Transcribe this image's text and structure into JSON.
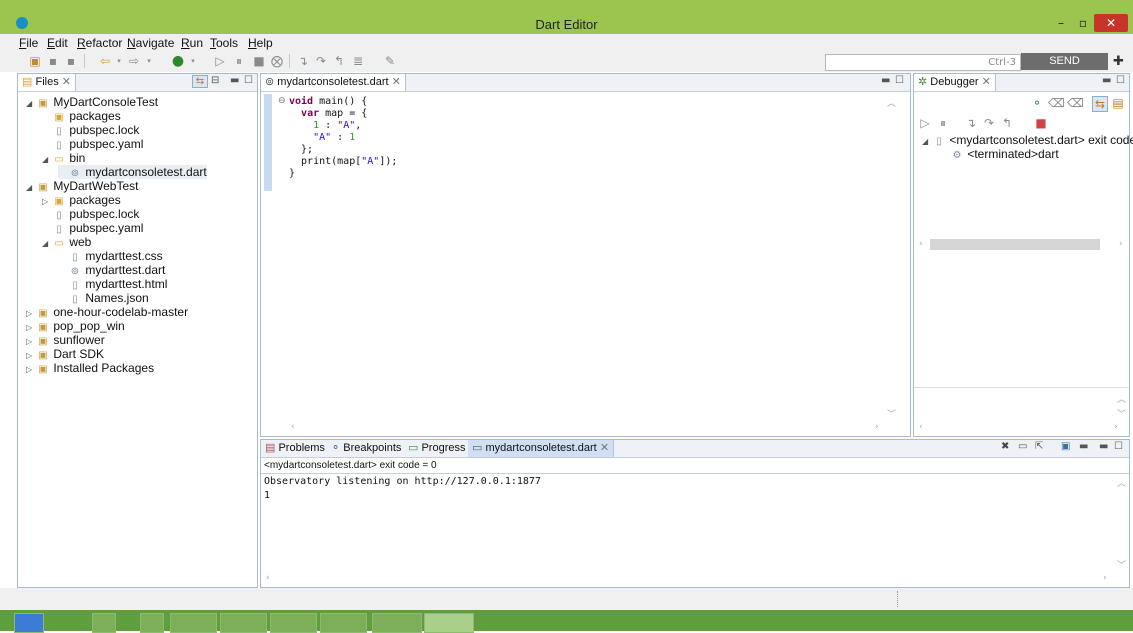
{
  "window": {
    "title": "Dart Editor",
    "min": "–",
    "max": "▫",
    "close": "✕"
  },
  "menu": [
    "File",
    "Edit",
    "Refactor",
    "Navigate",
    "Run",
    "Tools",
    "Help"
  ],
  "toolbar": {
    "search_placeholder": "Ctrl-3",
    "feedback_label": "SEND FEEDBACK"
  },
  "files_panel": {
    "tab": "Files",
    "tree": [
      {
        "label": "MyDartConsoleTest",
        "depth": 0,
        "twisty": "expanded",
        "icon": "project-folder"
      },
      {
        "label": "packages",
        "depth": 1,
        "twisty": "none",
        "icon": "package-folder"
      },
      {
        "label": "pubspec.lock",
        "depth": 1,
        "twisty": "none",
        "icon": "file"
      },
      {
        "label": "pubspec.yaml",
        "depth": 1,
        "twisty": "none",
        "icon": "yaml-file"
      },
      {
        "label": "bin",
        "depth": 1,
        "twisty": "expanded",
        "icon": "folder"
      },
      {
        "label": "mydartconsoletest.dart",
        "depth": 2,
        "twisty": "none",
        "icon": "dart-file",
        "selected": true
      },
      {
        "label": "MyDartWebTest",
        "depth": 0,
        "twisty": "expanded",
        "icon": "project-folder"
      },
      {
        "label": "packages",
        "depth": 1,
        "twisty": "collapsed",
        "icon": "package-folder"
      },
      {
        "label": "pubspec.lock",
        "depth": 1,
        "twisty": "none",
        "icon": "file"
      },
      {
        "label": "pubspec.yaml",
        "depth": 1,
        "twisty": "none",
        "icon": "yaml-file"
      },
      {
        "label": "web",
        "depth": 1,
        "twisty": "expanded",
        "icon": "folder"
      },
      {
        "label": "mydarttest.css",
        "depth": 2,
        "twisty": "none",
        "icon": "file"
      },
      {
        "label": "mydarttest.dart",
        "depth": 2,
        "twisty": "none",
        "icon": "dart-file"
      },
      {
        "label": "mydarttest.html",
        "depth": 2,
        "twisty": "none",
        "icon": "file"
      },
      {
        "label": "Names.json",
        "depth": 2,
        "twisty": "none",
        "icon": "file"
      },
      {
        "label": "one-hour-codelab-master",
        "depth": 0,
        "twisty": "collapsed",
        "icon": "project-folder"
      },
      {
        "label": "pop_pop_win",
        "depth": 0,
        "twisty": "collapsed",
        "icon": "project-folder"
      },
      {
        "label": "sunflower",
        "depth": 0,
        "twisty": "collapsed",
        "icon": "project-folder"
      },
      {
        "label": "Dart SDK",
        "depth": 0,
        "twisty": "collapsed",
        "icon": "library-folder"
      },
      {
        "label": "Installed Packages",
        "depth": 0,
        "twisty": "collapsed",
        "icon": "library-folder"
      }
    ]
  },
  "editor": {
    "tab": "mydartconsoletest.dart",
    "lines": [
      [
        {
          "t": "void",
          "c": "kw"
        },
        {
          "t": " main() {",
          "c": ""
        }
      ],
      [
        {
          "t": "  ",
          "c": ""
        },
        {
          "t": "var",
          "c": "kw"
        },
        {
          "t": " map = {",
          "c": ""
        }
      ],
      [
        {
          "t": "    ",
          "c": ""
        },
        {
          "t": "1",
          "c": "num"
        },
        {
          "t": " : ",
          "c": ""
        },
        {
          "t": "\"A\"",
          "c": "str"
        },
        {
          "t": ",",
          "c": ""
        }
      ],
      [
        {
          "t": "    ",
          "c": ""
        },
        {
          "t": "\"A\"",
          "c": "str"
        },
        {
          "t": " : ",
          "c": ""
        },
        {
          "t": "1",
          "c": "num"
        }
      ],
      [
        {
          "t": "  };",
          "c": ""
        }
      ],
      [
        {
          "t": "  print(map[",
          "c": ""
        },
        {
          "t": "\"A\"",
          "c": "str"
        },
        {
          "t": "]);",
          "c": ""
        }
      ],
      [
        {
          "t": "}",
          "c": ""
        }
      ]
    ]
  },
  "debugger": {
    "tab": "Debugger",
    "items": [
      {
        "label": "<mydartconsoletest.dart> exit code"
      },
      {
        "label": "<terminated>dart"
      }
    ]
  },
  "console": {
    "tabs": [
      "Problems",
      "Breakpoints",
      "Progress",
      "mydartconsoletest.dart"
    ],
    "header": "<mydartconsoletest.dart>  exit code = 0",
    "output": [
      "Observatory listening on http://127.0.0.1:1877",
      "1"
    ]
  }
}
